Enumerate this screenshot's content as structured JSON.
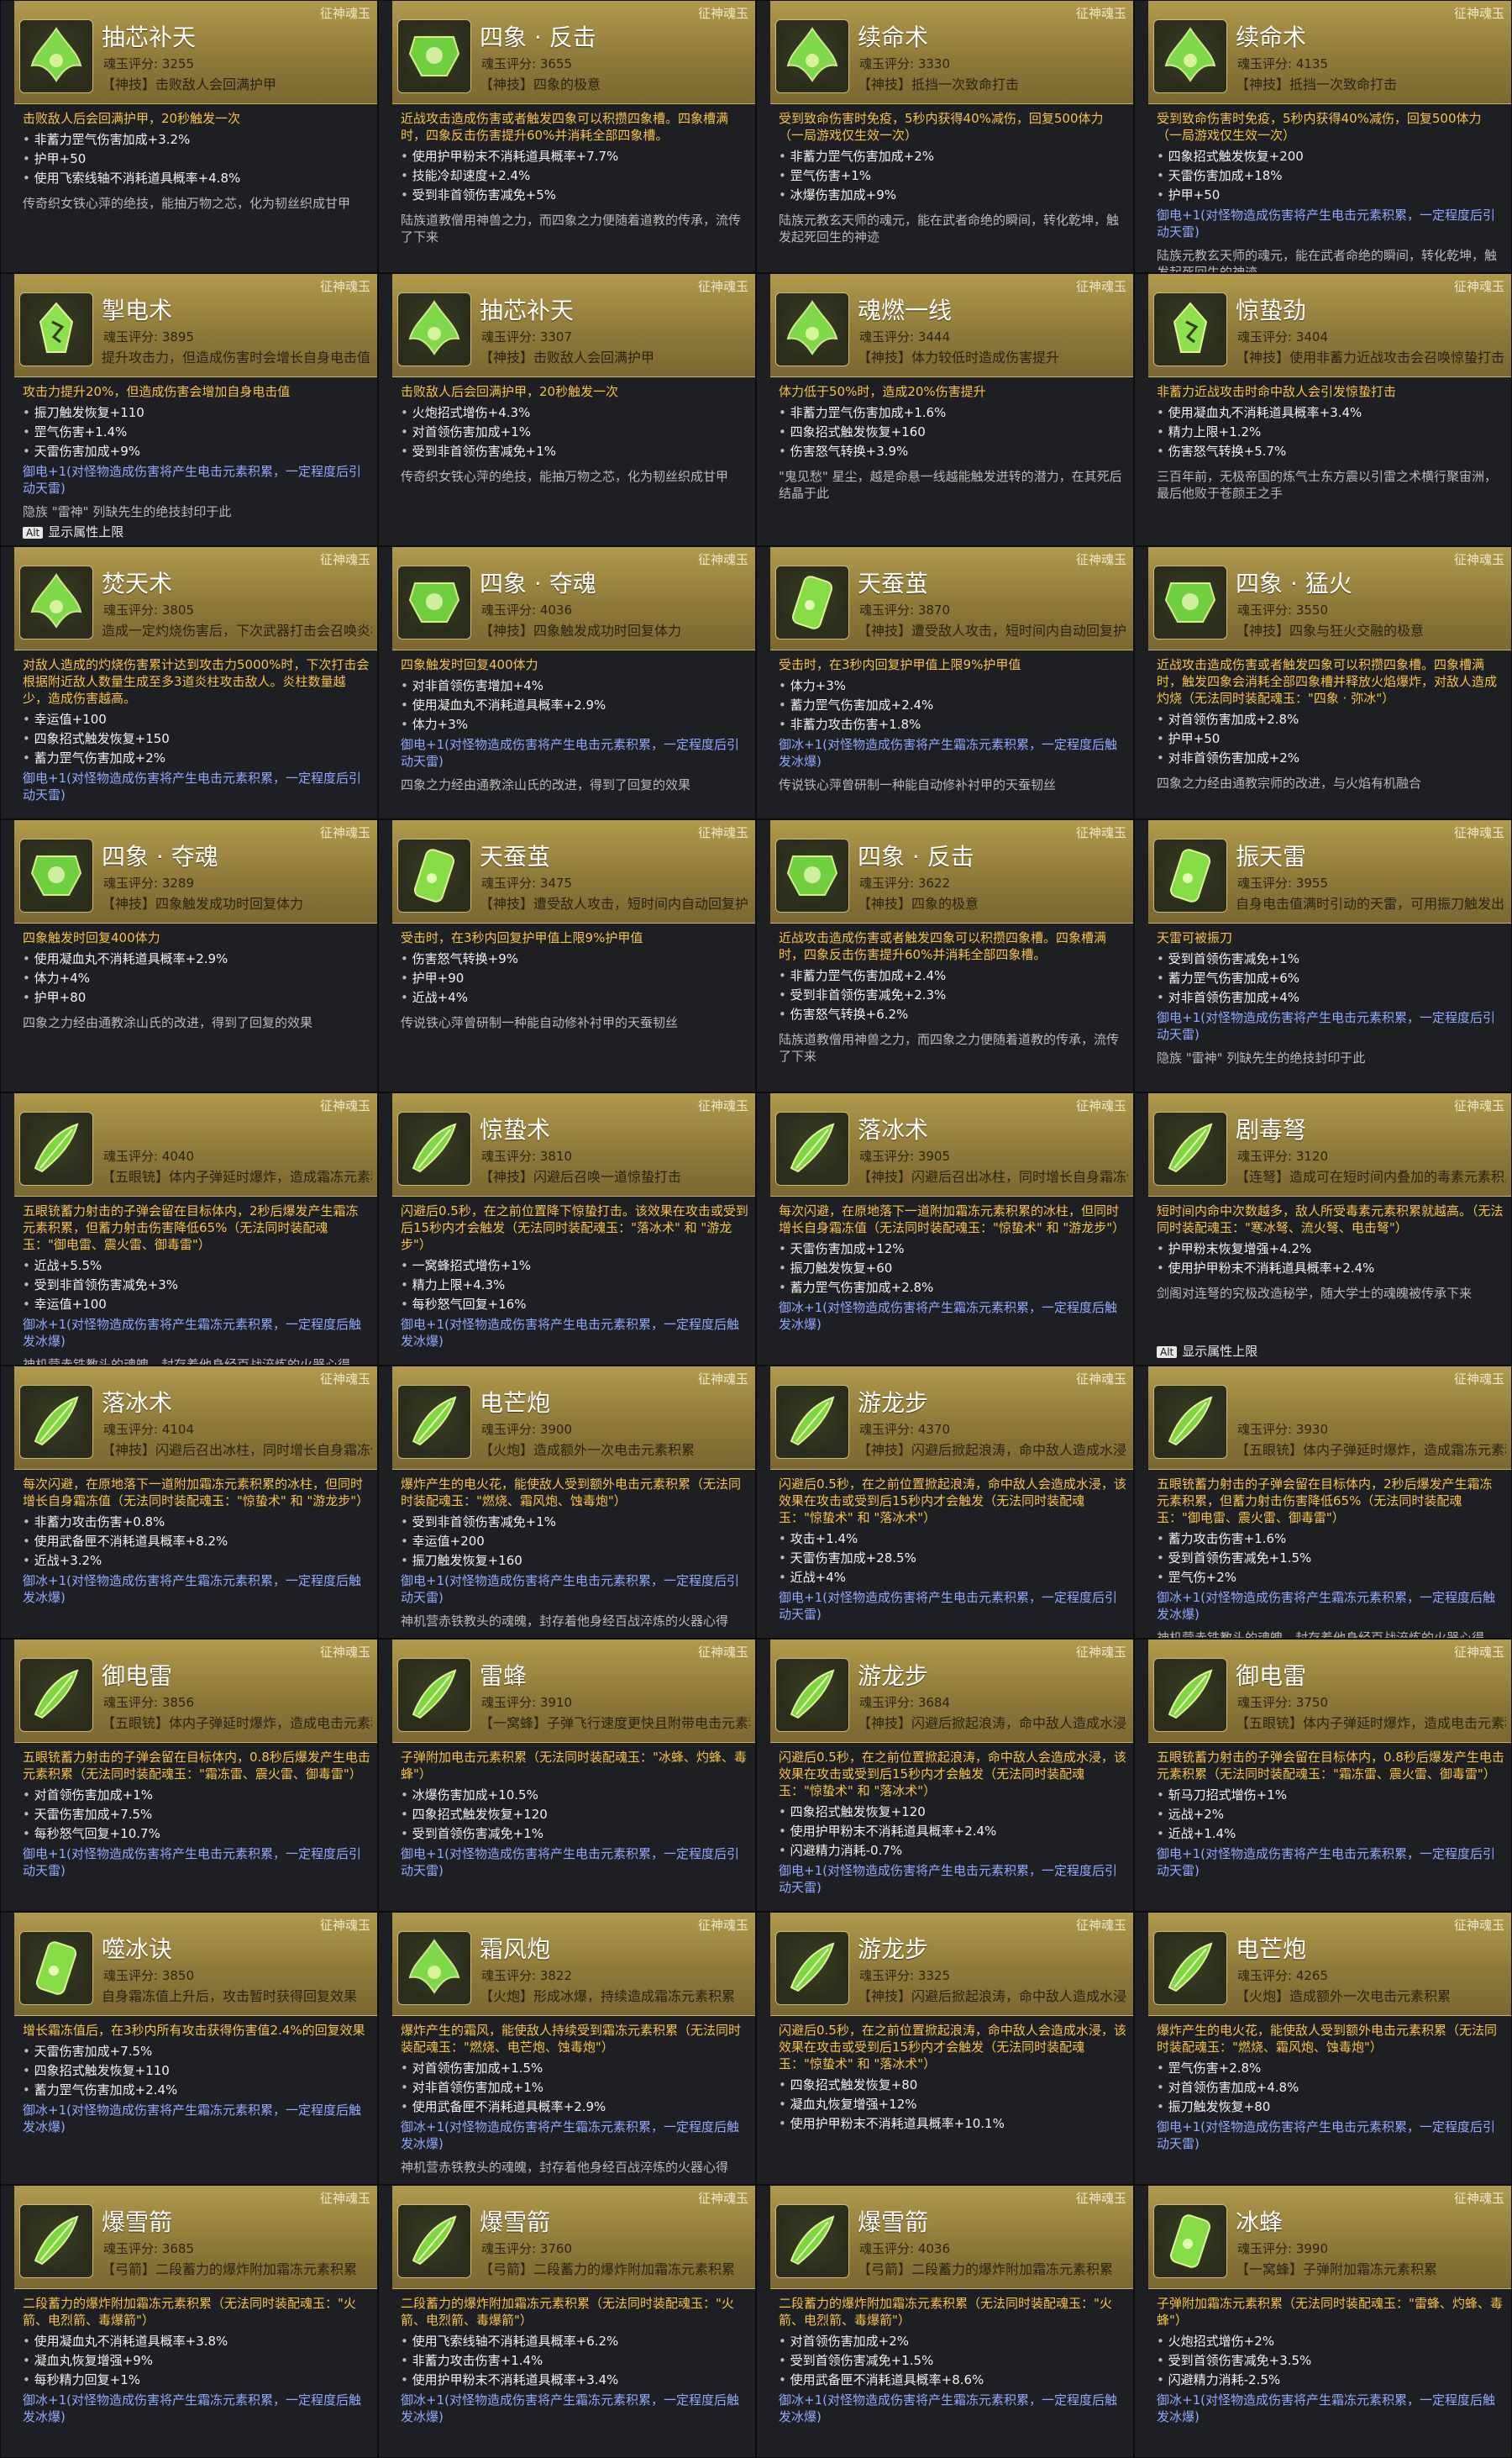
{
  "tag": "征神魂玉",
  "alt_key": "Alt",
  "alt_label": "显示属性上限",
  "cards": [
    {
      "name": "抽芯补天",
      "score": "魂玉评分: 3255",
      "skill": "【神技】击败敌人会回满护甲",
      "lead": "击败敌人后会回满护甲，20秒触发一次",
      "stats": [
        "非蓄力罡气伤害加成+3.2%",
        "护甲+50",
        "使用飞索线轴不消耗道具概率+4.8%"
      ],
      "blue": "",
      "lore": "传奇织女铁心萍的绝技，能抽万物之芯，化为韧丝织成甘甲",
      "icon": "a"
    },
    {
      "name": "四象 · 反击",
      "score": "魂玉评分: 3655",
      "skill": "【神技】四象的极意",
      "lead": "近战攻击造成伤害或者触发四象可以积攒四象槽。四象槽满时，四象反击伤害提升60%并消耗全部四象槽。",
      "stats": [
        "使用护甲粉末不消耗道具概率+7.7%",
        "技能冷却速度+2.4%",
        "受到非首领伤害减免+5%"
      ],
      "blue": "",
      "lore": "陆族道教僧用神兽之力，而四象之力便随着道教的传承，流传了下来",
      "icon": "b"
    },
    {
      "name": "续命术",
      "score": "魂玉评分: 3330",
      "skill": "【神技】抵挡一次致命打击",
      "lead": "受到致命伤害时免疫，5秒内获得40%减伤，回复500体力（一局游戏仅生效一次）",
      "stats": [
        "非蓄力罡气伤害加成+2%",
        "罡气伤害+1%",
        "冰爆伤害加成+9%"
      ],
      "blue": "",
      "lore": "陆族元教玄天师的魂元，能在武者命绝的瞬间，转化乾坤，触发起死回生的神迹",
      "icon": "a"
    },
    {
      "name": "续命术",
      "score": "魂玉评分: 4135",
      "skill": "【神技】抵挡一次致命打击",
      "lead": "受到致命伤害时免疫，5秒内获得40%减伤，回复500体力（一局游戏仅生效一次）",
      "stats": [
        "四象招式触发恢复+200",
        "天雷伤害加成+18%",
        "护甲+50"
      ],
      "blue": "御电+1(对怪物造成伤害将产生电击元素积累，一定程度后引动天雷)",
      "lore": "陆族元教玄天师的魂元，能在武者命绝的瞬间，转化乾坤，触发起死回生的神迹",
      "icon": "a"
    },
    {
      "name": "掣电术",
      "score": "魂玉评分: 3895",
      "skill": "提升攻击力，但造成伤害时会增长自身电击值",
      "lead": "攻击力提升20%，但造成伤害会增加自身电击值",
      "stats": [
        "振刀触发恢复+110",
        "罡气伤害+1.4%",
        "天雷伤害加成+9%"
      ],
      "blue": "御电+1(对怪物造成伤害将产生电击元素积累，一定程度后引动天雷)",
      "lore": "隐族 \"雷神\" 列缺先生的绝技封印于此",
      "icon": "c"
    },
    {
      "name": "抽芯补天",
      "score": "魂玉评分: 3307",
      "skill": "【神技】击败敌人会回满护甲",
      "lead": "击败敌人后会回满护甲，20秒触发一次",
      "stats": [
        "火炮招式增伤+4.3%",
        "对首领伤害加成+1%",
        "受到非首领伤害减免+1%"
      ],
      "blue": "",
      "lore": "传奇织女铁心萍的绝技，能抽万物之芯，化为韧丝织成甘甲",
      "icon": "a"
    },
    {
      "name": "魂燃一线",
      "score": "魂玉评分: 3444",
      "skill": "【神技】体力较低时造成伤害提升",
      "lead": "体力低于50%时，造成20%伤害提升",
      "stats": [
        "非蓄力罡气伤害加成+1.6%",
        "四象招式触发恢复+160",
        "伤害怒气转换+3.9%"
      ],
      "blue": "",
      "lore": "\"鬼见愁\" 星尘，越是命悬一线越能触发迸转的潜力，在其死后结晶于此",
      "icon": "a"
    },
    {
      "name": "惊蛰劲",
      "score": "魂玉评分: 3404",
      "skill": "【神技】使用非蓄力近战攻击会召唤惊蛰打击",
      "lead": "非蓄力近战攻击时命中敌人会引发惊蛰打击",
      "stats": [
        "使用凝血丸不消耗道具概率+3.4%",
        "精力上限+1.2%",
        "伤害怒气转换+5.7%"
      ],
      "blue": "",
      "lore": "三百年前，无极帝国的炼气士东方震以引雷之术横行聚宙洲，最后他败于苍颜王之手",
      "icon": "c"
    },
    {
      "name": "焚天术",
      "score": "魂玉评分: 3805",
      "skill": "造成一定灼烧伤害后，下次武器打击会召唤炎柱攻击敌人",
      "lead": "对敌人造成的灼烧伤害累计达到攻击力5000%时，下次打击会根据附近敌人数量生成至多3道炎柱攻击敌人。炎柱数量越少，造成伤害越高。",
      "stats": [
        "幸运值+100",
        "四象招式触发恢复+150",
        "蓄力罡气伤害加成+2%"
      ],
      "blue": "御电+1(对怪物造成伤害将产生电击元素积累，一定程度后引动天雷)",
      "lore": "",
      "icon": "a"
    },
    {
      "name": "四象 · 夺魂",
      "score": "魂玉评分: 4036",
      "skill": "【神技】四象触发成功时回复体力",
      "lead": "四象触发时回复400体力",
      "stats": [
        "对非首领伤害增加+4%",
        "使用凝血丸不消耗道具概率+2.9%",
        "体力+3%"
      ],
      "blue": "御电+1(对怪物造成伤害将产生电击元素积累，一定程度后引动天雷)",
      "lore": "四象之力经由通教涂山氏的改进，得到了回复的效果",
      "icon": "b"
    },
    {
      "name": "天蚕茧",
      "score": "魂玉评分: 3870",
      "skill": "【神技】遭受敌人攻击，短时间内自动回复护甲值",
      "lead": "受击时，在3秒内回复护甲值上限9%护甲值",
      "stats": [
        "体力+3%",
        "蓄力罡气伤害加成+2.4%",
        "非蓄力攻击伤害+1.8%"
      ],
      "blue": "御冰+1(对怪物造成伤害将产生霜冻元素积累，一定程度后触发冰爆)",
      "lore": "传说铁心萍曾研制一种能自动修补衬甲的天蚕韧丝",
      "icon": "d"
    },
    {
      "name": "四象 · 猛火",
      "score": "魂玉评分: 3550",
      "skill": "【神技】四象与狂火交融的极意",
      "lead": "近战攻击造成伤害或者触发四象可以积攒四象槽。四象槽满时，触发四象会消耗全部四象槽并释放火焰爆炸，对敌人造成灼烧（无法同时装配魂玉：\"四象 · 弥冰\"）",
      "stats": [
        "对首领伤害加成+2.8%",
        "护甲+50",
        "对非首领伤害加成+2%"
      ],
      "blue": "",
      "lore": "四象之力经由通教宗师的改进，与火焰有机融合",
      "icon": "b"
    },
    {
      "name": "四象 · 夺魂",
      "score": "魂玉评分: 3289",
      "skill": "【神技】四象触发成功时回复体力",
      "lead": "四象触发时回复400体力",
      "stats": [
        "使用凝血丸不消耗道具概率+2.9%",
        "体力+4%",
        "护甲+80"
      ],
      "blue": "",
      "lore": "四象之力经由通教涂山氏的改进，得到了回复的效果",
      "icon": "b"
    },
    {
      "name": "天蚕茧",
      "score": "魂玉评分: 3475",
      "skill": "【神技】遭受敌人攻击，短时间内自动回复护甲值",
      "lead": "受击时，在3秒内回复护甲值上限9%护甲值",
      "stats": [
        "伤害怒气转换+9%",
        "护甲+90",
        "近战+4%"
      ],
      "blue": "",
      "lore": "传说铁心萍曾研制一种能自动修补衬甲的天蚕韧丝",
      "icon": "d"
    },
    {
      "name": "四象 · 反击",
      "score": "魂玉评分: 3622",
      "skill": "【神技】四象的极意",
      "lead": "近战攻击造成伤害或者触发四象可以积攒四象槽。四象槽满时，四象反击伤害提升60%并消耗全部四象槽。",
      "stats": [
        "非蓄力罡气伤害加成+2.4%",
        "受到非首领伤害减免+2.3%",
        "伤害怒气转换+6.2%"
      ],
      "blue": "",
      "lore": "陆族道教僧用神兽之力，而四象之力便随着道教的传承，流传了下来",
      "icon": "b"
    },
    {
      "name": "振天雷",
      "score": "魂玉评分: 3955",
      "skill": "自身电击值满时引动的天雷，可用振刀触发出",
      "lead": "天雷可被振刀",
      "stats": [
        "受到首领伤害减免+1%",
        "蓄力罡气伤害加成+6%",
        "对非首领伤害加成+4%"
      ],
      "blue": "御电+1(对怪物造成伤害将产生电击元素积累，一定程度后引动天雷)",
      "lore": "隐族 \"雷神\" 列缺先生的绝技封印于此",
      "icon": "d"
    },
    {
      "name": "",
      "score": "魂玉评分: 4040",
      "skill": "【五眼铳】体内子弹延时爆炸，造成霜冻元素积累",
      "lead": "五眼铳蓄力射击的子弹会留在目标体内，2秒后爆发产生霜冻元素积累，但蓄力射击伤害降低65%（无法同时装配魂玉：\"御电雷、震火雷、御毒雷\"）",
      "stats": [
        "近战+5.5%",
        "受到非首领伤害减免+3%",
        "幸运值+100"
      ],
      "blue": "御冰+1(对怪物造成伤害将产生霜冻元素积累，一定程度后触发冰爆)",
      "lore": "神机营赤铁教头的魂魄，封存着他身经百战淬炼的火器心得",
      "icon": "e"
    },
    {
      "name": "惊蛰术",
      "score": "魂玉评分: 3810",
      "skill": "【神技】闪避后召唤一道惊蛰打击",
      "lead": "闪避后0.5秒，在之前位置降下惊蛰打击。该效果在攻击或受到后15秒内才会触发（无法同时装配魂玉：\"落冰术\" 和 \"游龙步\"）",
      "stats": [
        "一窝蜂招式增伤+1%",
        "精力上限+4.3%",
        "每秒怒气回复+16%"
      ],
      "blue": "御电+1(对怪物造成伤害将产生电击元素积累，一定程度后触发冰爆)",
      "lore": "",
      "icon": "e"
    },
    {
      "name": "落冰术",
      "score": "魂玉评分: 3905",
      "skill": "【神技】闪避后召出冰柱，同时增长自身霜冻值",
      "lead": "每次闪避，在原地落下一道附加霜冻元素积累的冰柱，但同时增长自身霜冻值（无法同时装配魂玉：\"惊蛰术\" 和 \"游龙步\"）",
      "stats": [
        "天雷伤害加成+12%",
        "振刀触发恢复+60",
        "蓄力罡气伤害加成+2.8%"
      ],
      "blue": "御冰+1(对怪物造成伤害将产生霜冻元素积累，一定程度后触发冰爆)",
      "lore": "",
      "icon": "e"
    },
    {
      "name": "剧毒弩",
      "score": "魂玉评分: 3120",
      "skill": "【连弩】造成可在短时间内叠加的毒素元素积累",
      "lead": "短时间内命中次数越多，敌人所受毒素元素积累就越高。（无法同时装配魂玉：\"寒冰弩、流火弩、电击弩\"）",
      "stats": [
        "护甲粉末恢复增强+4.2%",
        "使用护甲粉末不消耗道具概率+2.4%"
      ],
      "blue": "",
      "lore": "剑阁对连弩的究极改造秘学，随大学士的魂魄被传承下来",
      "icon": "e"
    },
    {
      "name": "落冰术",
      "score": "魂玉评分: 4104",
      "skill": "【神技】闪避后召出冰柱，同时增长自身霜冻值",
      "lead": "每次闪避，在原地落下一道附加霜冻元素积累的冰柱，但同时增长自身霜冻值（无法同时装配魂玉：\"惊蛰术\" 和 \"游龙步\"）",
      "stats": [
        "非蓄力攻击伤害+0.8%",
        "使用武备匣不消耗道具概率+8.2%",
        "近战+3.2%"
      ],
      "blue": "御冰+1(对怪物造成伤害将产生霜冻元素积累，一定程度后触发冰爆)",
      "lore": "",
      "icon": "e"
    },
    {
      "name": "电芒炮",
      "score": "魂玉评分: 3900",
      "skill": "【火炮】造成额外一次电击元素积累",
      "lead": "爆炸产生的电火花，能使敌人受到额外电击元素积累（无法同时装配魂玉：\"燃烧、霜风炮、蚀毒炮\"）",
      "stats": [
        "受到非首领伤害减免+1%",
        "幸运值+200",
        "振刀触发恢复+160"
      ],
      "blue": "御电+1(对怪物造成伤害将产生电击元素积累，一定程度后引动天雷)",
      "lore": "神机营赤铁教头的魂魄，封存着他身经百战淬炼的火器心得",
      "icon": "e"
    },
    {
      "name": "游龙步",
      "score": "魂玉评分: 4370",
      "skill": "【神技】闪避后掀起浪涛，命中敌人造成水浸",
      "lead": "闪避后0.5秒，在之前位置掀起浪涛，命中敌人会造成水浸，该效果在攻击或受到后15秒内才会触发（无法同时装配魂玉：\"惊蛰术\" 和 \"落冰术\"）",
      "stats": [
        "攻击+1.4%",
        "天雷伤害加成+28.5%",
        "近战+4%"
      ],
      "blue": "御电+1(对怪物造成伤害将产生电击元素积累，一定程度后引动天雷)",
      "lore": "",
      "icon": "e"
    },
    {
      "name": "",
      "score": "魂玉评分: 3930",
      "skill": "【五眼铳】体内子弹延时爆炸，造成霜冻元素积累",
      "lead": "五眼铳蓄力射击的子弹会留在目标体内，2秒后爆发产生霜冻元素积累，但蓄力射击伤害降低65%（无法同时装配魂玉：\"御电雷、震火雷、御毒雷\"）",
      "stats": [
        "蓄力攻击伤害+1.6%",
        "受到首领伤害减免+1.5%",
        "罡气伤+2%"
      ],
      "blue": "御冰+1(对怪物造成伤害将产生霜冻元素积累，一定程度后触发冰爆)",
      "lore": "神机营赤铁教头的魂魄，封存着他身经百战淬炼的火器心得",
      "icon": "e"
    },
    {
      "name": "御电雷",
      "score": "魂玉评分: 3856",
      "skill": "【五眼铳】体内子弹延时爆炸，造成电击元素积累",
      "lead": "五眼铳蓄力射击的子弹会留在目标体内，0.8秒后爆发产生电击元素积累（无法同时装配魂玉：\"霜冻雷、震火雷、御毒雷\"）",
      "stats": [
        "对首领伤害加成+1%",
        "天雷伤害加成+7.5%",
        "每秒怒气回复+10.7%"
      ],
      "blue": "御电+1(对怪物造成伤害将产生电击元素积累，一定程度后引动天雷)",
      "lore": "",
      "icon": "e"
    },
    {
      "name": "雷蜂",
      "score": "魂玉评分: 3910",
      "skill": "【一窝蜂】子弹飞行速度更快且附带电击元素积累",
      "lead": "子弹附加电击元素积累（无法同时装配魂玉：\"冰蜂、灼蜂、毒蜂\"）",
      "stats": [
        "冰爆伤害加成+10.5%",
        "四象招式触发恢复+120",
        "受到首领伤害减免+1%"
      ],
      "blue": "御电+1(对怪物造成伤害将产生电击元素积累，一定程度后引动天雷)",
      "lore": "",
      "icon": "e"
    },
    {
      "name": "游龙步",
      "score": "魂玉评分: 3684",
      "skill": "【神技】闪避后掀起浪涛，命中敌人造成水浸",
      "lead": "闪避后0.5秒，在之前位置掀起浪涛，命中敌人会造成水浸，该效果在攻击或受到后15秒内才会触发（无法同时装配魂玉：\"惊蛰术\" 和 \"落冰术\"）",
      "stats": [
        "四象招式触发恢复+120",
        "使用护甲粉末不消耗道具概率+2.4%",
        "闪避精力消耗-0.7%"
      ],
      "blue": "御电+1(对怪物造成伤害将产生电击元素积累，一定程度后引动天雷)",
      "lore": "",
      "icon": "e"
    },
    {
      "name": "御电雷",
      "score": "魂玉评分: 3750",
      "skill": "【五眼铳】体内子弹延时爆炸，造成电击元素积累",
      "lead": "五眼铳蓄力射击的子弹会留在目标体内，0.8秒后爆发产生电击元素积累（无法同时装配魂玉：\"霜冻雷、震火雷、御毒雷\"）",
      "stats": [
        "斩马刀招式增伤+1%",
        "远战+2%",
        "近战+1.4%"
      ],
      "blue": "御电+1(对怪物造成伤害将产生电击元素积累，一定程度后引动天雷)",
      "lore": "",
      "icon": "e"
    },
    {
      "name": "噬冰诀",
      "score": "魂玉评分: 3850",
      "skill": "自身霜冻值上升后，攻击暂时获得回复效果",
      "lead": "增长霜冻值后，在3秒内所有攻击获得伤害值2.4%的回复效果",
      "stats": [
        "天雷伤害加成+7.5%",
        "四象招式触发恢复+110",
        "蓄力罡气伤害加成+2.4%"
      ],
      "blue": "御冰+1(对怪物造成伤害将产生霜冻元素积累，一定程度后触发冰爆)",
      "lore": "",
      "icon": "d"
    },
    {
      "name": "霜风炮",
      "score": "魂玉评分: 3822",
      "skill": "【火炮】形成冰爆，持续造成霜冻元素积累",
      "lead": "爆炸产生的霜风，能使敌人持续受到霜冻元素积累（无法同时装配魂玉：\"燃烧、电芒炮、蚀毒炮\"）",
      "stats": [
        "对首领伤害加成+1.5%",
        "对非首领伤害加成+1%",
        "使用武备匣不消耗道具概率+2.9%"
      ],
      "blue": "御冰+1(对怪物造成伤害将产生霜冻元素积累，一定程度后触发冰爆)",
      "lore": "神机营赤铁教头的魂魄，封存着他身经百战淬炼的火器心得",
      "icon": "a"
    },
    {
      "name": "游龙步",
      "score": "魂玉评分: 3325",
      "skill": "【神技】闪避后掀起浪涛，命中敌人造成水浸",
      "lead": "闪避后0.5秒，在之前位置掀起浪涛，命中敌人会造成水浸，该效果在攻击或受到后15秒内才会触发（无法同时装配魂玉：\"惊蛰术\" 和 \"落冰术\"）",
      "stats": [
        "四象招式触发恢复+80",
        "凝血丸恢复增强+12%",
        "使用护甲粉末不消耗道具概率+10.1%"
      ],
      "blue": "",
      "lore": "",
      "icon": "e"
    },
    {
      "name": "电芒炮",
      "score": "魂玉评分: 4265",
      "skill": "【火炮】造成额外一次电击元素积累",
      "lead": "爆炸产生的电火花，能使敌人受到额外电击元素积累（无法同时装配魂玉：\"燃烧、霜风炮、蚀毒炮\"）",
      "stats": [
        "罡气伤害+2.8%",
        "对首领伤害加成+4.8%",
        "振刀触发恢复+80"
      ],
      "blue": "御电+1(对怪物造成伤害将产生电击元素积累，一定程度后引动天雷)",
      "lore": "",
      "icon": "e"
    },
    {
      "name": "爆雪箭",
      "score": "魂玉评分: 3685",
      "skill": "【弓箭】二段蓄力的爆炸附加霜冻元素积累",
      "lead": "二段蓄力的爆炸附加霜冻元素积累（无法同时装配魂玉：\"火箭、电烈箭、毒爆箭\"）",
      "stats": [
        "使用凝血丸不消耗道具概率+3.8%",
        "凝血丸恢复增强+9%",
        "每秒精力回复+1%"
      ],
      "blue": "御冰+1(对怪物造成伤害将产生霜冻元素积累，一定程度后触发冰爆)",
      "lore": "",
      "icon": "e"
    },
    {
      "name": "爆雪箭",
      "score": "魂玉评分: 3760",
      "skill": "【弓箭】二段蓄力的爆炸附加霜冻元素积累",
      "lead": "二段蓄力的爆炸附加霜冻元素积累（无法同时装配魂玉：\"火箭、电烈箭、毒爆箭\"）",
      "stats": [
        "使用飞索线轴不消耗道具概率+6.2%",
        "非蓄力攻击伤害+1.4%",
        "使用护甲粉末不消耗道具概率+3.4%"
      ],
      "blue": "御冰+1(对怪物造成伤害将产生霜冻元素积累，一定程度后触发冰爆)",
      "lore": "",
      "icon": "e"
    },
    {
      "name": "爆雪箭",
      "score": "魂玉评分: 4036",
      "skill": "【弓箭】二段蓄力的爆炸附加霜冻元素积累",
      "lead": "二段蓄力的爆炸附加霜冻元素积累（无法同时装配魂玉：\"火箭、电烈箭、毒爆箭\"）",
      "stats": [
        "对首领伤害加成+2%",
        "受到首领伤害减免+1.5%",
        "使用武备匣不消耗道具概率+8.6%"
      ],
      "blue": "御冰+1(对怪物造成伤害将产生霜冻元素积累，一定程度后触发冰爆)",
      "lore": "",
      "icon": "e"
    },
    {
      "name": "冰蜂",
      "score": "魂玉评分: 3990",
      "skill": "【一窝蜂】子弹附加霜冻元素积累",
      "lead": "子弹附加霜冻元素积累（无法同时装配魂玉：\"雷蜂、灼蜂、毒蜂\"）",
      "stats": [
        "火炮招式增伤+2%",
        "受到首领伤害减免+3.5%",
        "闪避精力消耗-2.5%"
      ],
      "blue": "御冰+1(对怪物造成伤害将产生霜冻元素积累，一定程度后触发冰爆)",
      "lore": "",
      "icon": "d"
    }
  ]
}
